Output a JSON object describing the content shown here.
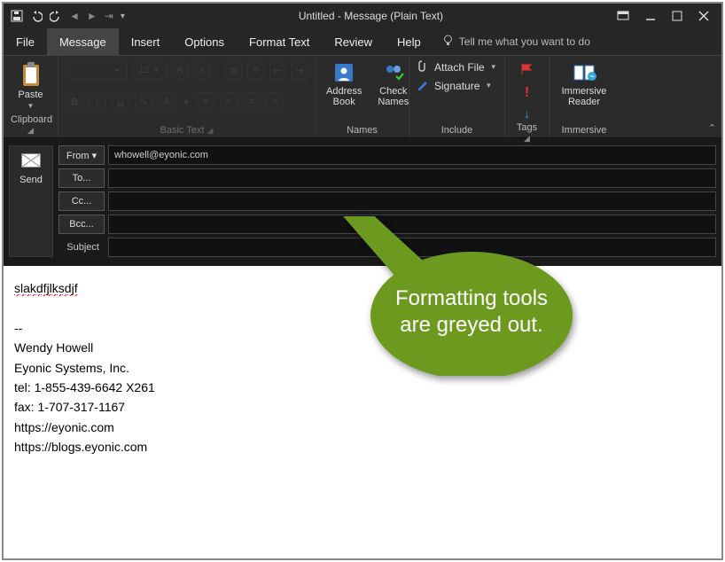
{
  "title": "Untitled  -  Message (Plain Text)",
  "menu": {
    "file": "File",
    "message": "Message",
    "insert": "Insert",
    "options": "Options",
    "format": "Format Text",
    "review": "Review",
    "help": "Help",
    "tellme": "Tell me what you want to do"
  },
  "ribbon": {
    "clipboard": {
      "paste": "Paste",
      "label": "Clipboard"
    },
    "basictext": {
      "font": "",
      "size": "12",
      "label": "Basic Text"
    },
    "names": {
      "addr": "Address Book",
      "check": "Check Names",
      "label": "Names"
    },
    "include": {
      "attach": "Attach File",
      "sig": "Signature",
      "label": "Include"
    },
    "tags": {
      "label": "Tags"
    },
    "immersive": {
      "btn": "Immersive Reader",
      "label": "Immersive"
    }
  },
  "addr": {
    "send": "Send",
    "fromBtn": "From ▾",
    "from": "whowell@eyonic.com",
    "to": "To...",
    "cc": "Cc...",
    "bcc": "Bcc...",
    "subject": "Subject"
  },
  "body": {
    "typed": "slakdfjlksdjf",
    "sigsep": "--",
    "name": "Wendy Howell",
    "company": "Eyonic Systems, Inc.",
    "tel": "tel: 1-855-439-6642 X261",
    "fax": "fax: 1-707-317-1167",
    "url1": "https://eyonic.com",
    "url2": "https://blogs.eyonic.com"
  },
  "callout": {
    "line1": "Formatting tools",
    "line2": "are greyed out."
  }
}
